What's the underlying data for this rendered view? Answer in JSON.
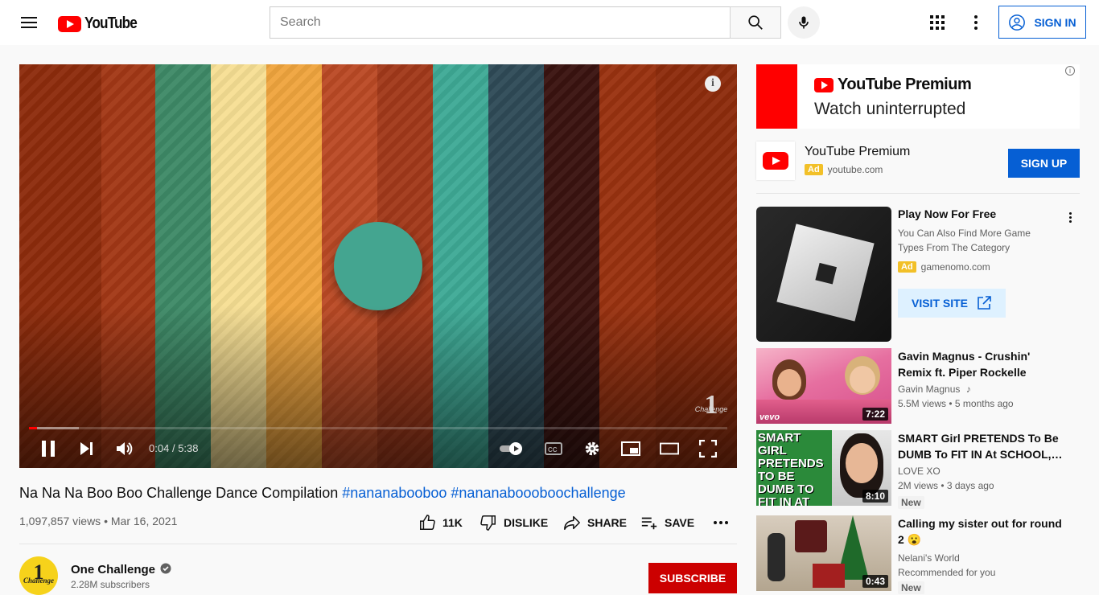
{
  "header": {
    "logo_text": "YouTube",
    "search_placeholder": "Search",
    "sign_in_label": "SIGN IN"
  },
  "player": {
    "time_current": "0:04",
    "time_separator": "/",
    "time_total": "5:38",
    "progress_played_fraction": 0.011,
    "progress_buffered_fraction": 0.071,
    "watermark_text": "1",
    "watermark_sub": "Challenge",
    "colors": {
      "background": "#8e2c0c",
      "ball": "#44a590"
    }
  },
  "video": {
    "title": "Na Na Na Boo Boo Challenge Dance Compilation",
    "hashtag_1": "#nananabooboo",
    "hashtag_2": "#nananaboooboochallenge",
    "views": "1,097,857 views",
    "date": "Mar 16, 2021",
    "like_count": "11K",
    "dislike_label": "DISLIKE",
    "share_label": "SHARE",
    "save_label": "SAVE"
  },
  "channel": {
    "name": "One Challenge",
    "subscribers": "2.28M subscribers",
    "avatar_text": "1",
    "avatar_sub": "Challenge",
    "subscribe_label": "SUBSCRIBE"
  },
  "sidebar": {
    "banner": {
      "brand": "YouTube Premium",
      "tagline": "Watch uninterrupted"
    },
    "premium_ad": {
      "title": "YouTube Premium",
      "ad_label": "Ad",
      "domain": "youtube.com",
      "cta": "SIGN UP"
    },
    "game_ad": {
      "title": "Play Now For Free",
      "description": "You Can Also Find More Game Types From The Category",
      "ad_label": "Ad",
      "domain": "gamenomo.com",
      "cta": "VISIT SITE"
    },
    "recommendations": [
      {
        "title": "Gavin Magnus - Crushin' Remix ft. Piper Rockelle (Official Mus…",
        "channel": "Gavin Magnus",
        "meta": "5.5M views • 5 months ago",
        "duration": "7:22",
        "badge": "",
        "thumb_label": "vevo"
      },
      {
        "title": "SMART Girl PRETENDS To Be DUMB To FIT IN At SCHOOL,…",
        "channel": "LOVE XO",
        "meta": "2M views • 3 days ago",
        "duration": "8:10",
        "badge": "New",
        "thumb_label": "SMART GIRL PRETENDS TO BE DUMB TO FIT IN AT SCHOOL"
      },
      {
        "title": "Calling my sister out for round 2 😮",
        "channel": "Nelani's World",
        "meta": "Recommended for you",
        "duration": "0:43",
        "badge": "New",
        "thumb_label": ""
      }
    ]
  }
}
